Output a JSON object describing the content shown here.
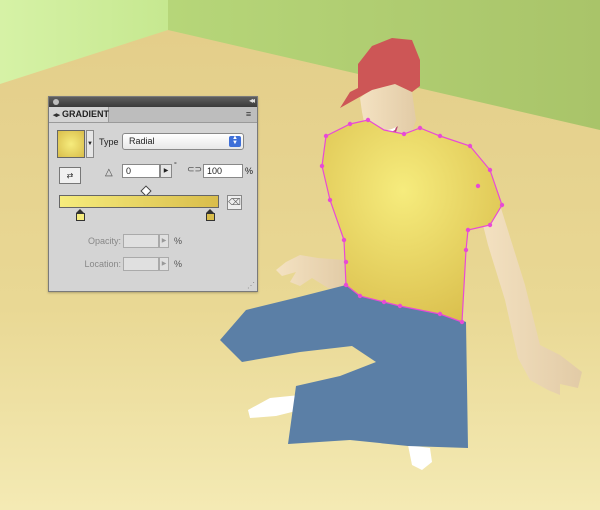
{
  "panel": {
    "title": "GRADIENT",
    "tab_arrows": "◂▸",
    "collapse_glyph": "◂◂",
    "menu_glyph": "≡",
    "type_label": "Type",
    "type_value": "Radial",
    "angle_value": "0",
    "angle_unit": "°",
    "aspect_value": "100",
    "aspect_unit": "%",
    "opacity_label": "Opacity:",
    "opacity_unit": "%",
    "location_label": "Location:",
    "location_unit": "%"
  },
  "colors": {
    "wall_green": "#a8c86a",
    "floor": "#e6d08a",
    "shirt_light": "#f6ec7d",
    "shirt_dark": "#d9bd4b",
    "jeans": "#5b7fa6",
    "cap": "#cd5656",
    "selection": "#e84ad6"
  },
  "icons": {
    "reverse": "reverse-gradient-icon",
    "angle": "angle-icon",
    "aspect": "aspect-ratio-icon",
    "delete": "trash-icon"
  }
}
